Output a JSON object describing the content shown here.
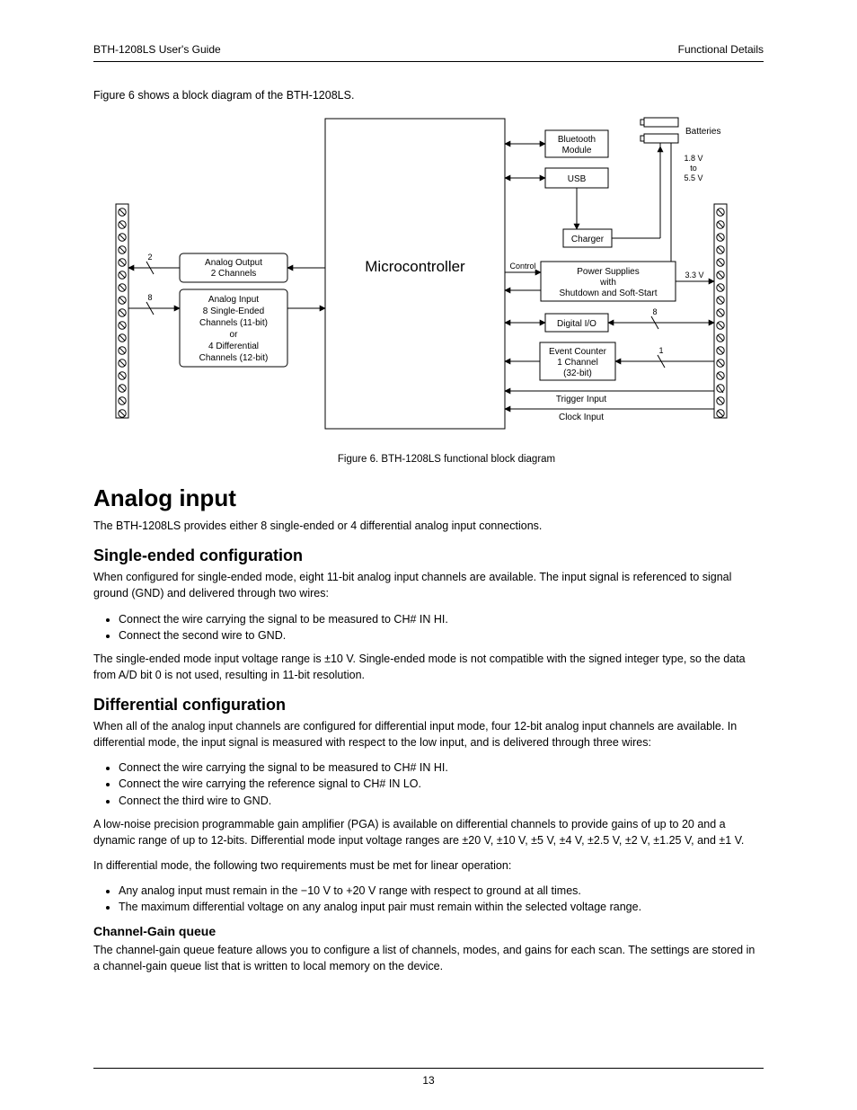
{
  "header": {
    "left": "BTH-1208LS User's Guide",
    "right": "Functional Details"
  },
  "intro": "Figure 6 shows a block diagram of the BTH-1208LS.",
  "caption": "Figure 6. BTH-1208LS functional block diagram",
  "diagram": {
    "micro": "Microcontroller",
    "analog_out": {
      "l1": "Analog Output",
      "l2": "2 Channels",
      "bus": "2"
    },
    "analog_in": {
      "l1": "Analog Input",
      "l2": "8 Single-Ended",
      "l3": "Channels (11-bit)",
      "l4": "or",
      "l5": "4 Differential",
      "l6": "Channels (12-bit)",
      "bus": "8"
    },
    "bluetooth": {
      "l1": "Bluetooth",
      "l2": "Module"
    },
    "usb": "USB",
    "charger": "Charger",
    "power": {
      "l1": "Power Supplies",
      "l2": "with",
      "l3": "Shutdown and Soft-Start"
    },
    "control": "Control",
    "dio": "Digital I/O",
    "dio_bus": "8",
    "event": {
      "l1": "Event Counter",
      "l2": "1 Channel",
      "l3": "(32-bit)",
      "bus": "1"
    },
    "trigger": "Trigger Input",
    "clock": "Clock Input",
    "batteries": "Batteries",
    "vin": {
      "l1": "1.8 V",
      "l2": "to",
      "l3": "5.5 V"
    },
    "vout": "3.3 V"
  },
  "section": "Analog input",
  "para1": "The BTH-1208LS provides either 8 single-ended or 4 differential analog input connections.",
  "sub1": "Single-ended configuration",
  "para2": "When configured for single-ended mode, eight 11-bit analog input channels are available. The input signal is referenced to signal ground (GND) and delivered through two wires:",
  "bullets1": [
    "Connect the wire carrying the signal to be measured to CH# IN HI.",
    "Connect the second wire to GND."
  ],
  "para3": "The single-ended mode input voltage range is ±10 V. Single-ended mode is not compatible with the signed integer type, so the data from A/D bit 0 is not used, resulting in 11-bit resolution.",
  "sub2": "Differential configuration",
  "para4": "When all of the analog input channels are configured for differential input mode, four 12-bit analog input channels are available. In differential mode, the input signal is measured with respect to the low input, and is delivered through three wires:",
  "bullets2": [
    "Connect the wire carrying the signal to be measured to CH# IN HI.",
    "Connect the wire carrying the reference signal to CH# IN LO.",
    "Connect the third wire to GND."
  ],
  "para5": "A low-noise precision programmable gain amplifier (PGA) is available on differential channels to provide gains of up to 20 and a dynamic range of up to 12-bits. Differential mode input voltage ranges are ±20 V, ±10 V, ±5 V, ±4 V, ±2.5 V, ±2 V, ±1.25 V, and ±1 V.",
  "para6": "In differential mode, the following two requirements must be met for linear operation:",
  "bullets3": [
    "Any analog input must remain in the −10 V to +20 V range with respect to ground at all times.",
    "The maximum differential voltage on any analog input pair must remain within the selected voltage range."
  ],
  "subsub": "Channel-Gain queue",
  "para7": "The channel-gain queue feature allows you to configure a list of channels, modes, and gains for each scan. The settings are stored in a channel-gain queue list that is written to local memory on the device.",
  "footer": {
    "page": "13"
  }
}
